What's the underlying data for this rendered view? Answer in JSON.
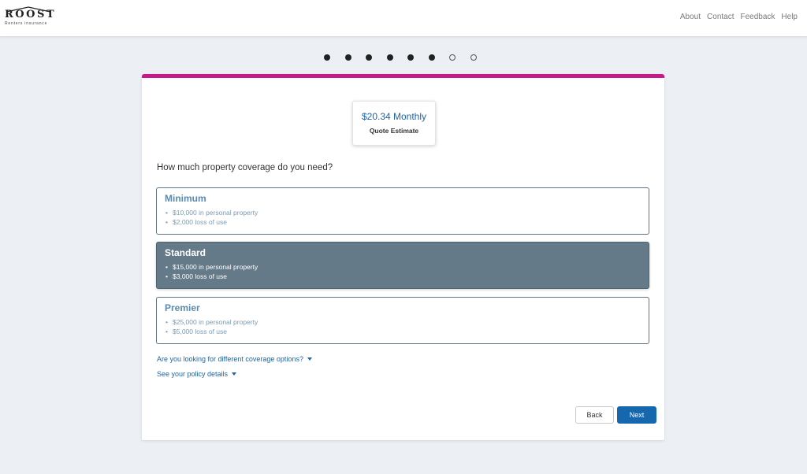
{
  "header": {
    "logo_text": "ROOST",
    "logo_subtitle": "Renters insurance",
    "nav": [
      "About",
      "Contact",
      "Feedback",
      "Help"
    ]
  },
  "progress": {
    "total_steps": 8,
    "completed_steps": 6
  },
  "quote": {
    "price": "$20.34 Monthly",
    "label": "Quote Estimate"
  },
  "question": "How much property coverage do you need?",
  "options": [
    {
      "title": "Minimum",
      "items": [
        "$10,000 in personal property",
        "$2,000 loss of use"
      ],
      "selected": false
    },
    {
      "title": "Standard",
      "items": [
        "$15,000 in personal property",
        "$3,000 loss of use"
      ],
      "selected": true
    },
    {
      "title": "Premier",
      "items": [
        "$25,000 in personal property",
        "$5,000 loss of use"
      ],
      "selected": false
    }
  ],
  "links": {
    "different_coverage": "Are you looking for different coverage options?",
    "policy_details": "See your policy details"
  },
  "buttons": {
    "back": "Back",
    "next": "Next"
  },
  "colors": {
    "accent_bar": "#c6198c",
    "primary": "#1567ae",
    "selected_option": "#647a88"
  }
}
